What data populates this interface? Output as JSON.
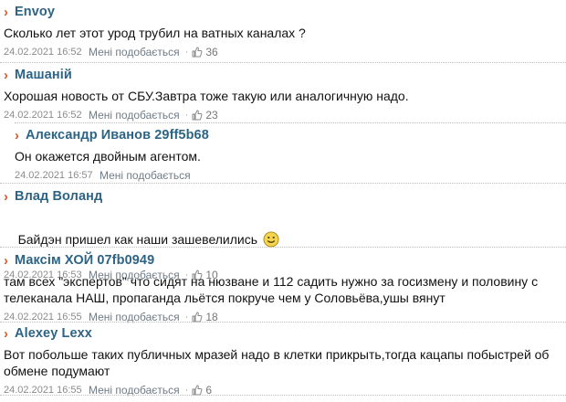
{
  "comments": [
    {
      "author": "Envoy",
      "text": "Сколько лет этот урод трубил на ватных каналах ?",
      "date": "24.02.2021 16:52",
      "like_label": "Мені подобається",
      "separator": "·",
      "likes": "36"
    },
    {
      "author": "Машаній",
      "text": "Хорошая новость от СБУ.Завтра тоже такую или аналогичную надо.",
      "date": "24.02.2021 16:52",
      "like_label": "Мені подобається",
      "separator": "·",
      "likes": "23"
    },
    {
      "author": "Александр Иванов 29ff5b68",
      "text": "Он окажется двойным агентом.",
      "date": "24.02.2021 16:57",
      "like_label": "Мені подобається"
    },
    {
      "author": "Влад Воланд",
      "text": "Байдэн пришел как наши зашевелились",
      "date": "24.02.2021 16:53",
      "like_label": "Мені подобається",
      "separator": "·",
      "likes": "10",
      "emoji": "smiley-face"
    },
    {
      "author": "Максім ХОЙ 07fb0949",
      "text": "там всех \"экспертов\" что сидят на нюзване и 112 садить нужно за госизмену и половину с\nтелеканала НАШ, пропаганда льётся покруче чем у Соловьёва,ушы вянут",
      "date": "24.02.2021 16:55",
      "like_label": "Мені подобається",
      "separator": "·",
      "likes": "18"
    },
    {
      "author": "Alexey Lexx",
      "text": "Вот побольше таких публичных мразей надо в клетки прикрыть,тогда кацапы побыстрей об\nобмене подумают",
      "date": "24.02.2021 16:55",
      "like_label": "Мені подобається",
      "separator": "·",
      "likes": "6"
    }
  ],
  "colors": {
    "author": "#2d6485",
    "chevron": "#d25c2c",
    "meta": "#8b8b8b",
    "separator": "#bdbdbd"
  },
  "icons": {
    "author_marker": "chevron-right-icon",
    "like": "thumbs-up-icon"
  }
}
